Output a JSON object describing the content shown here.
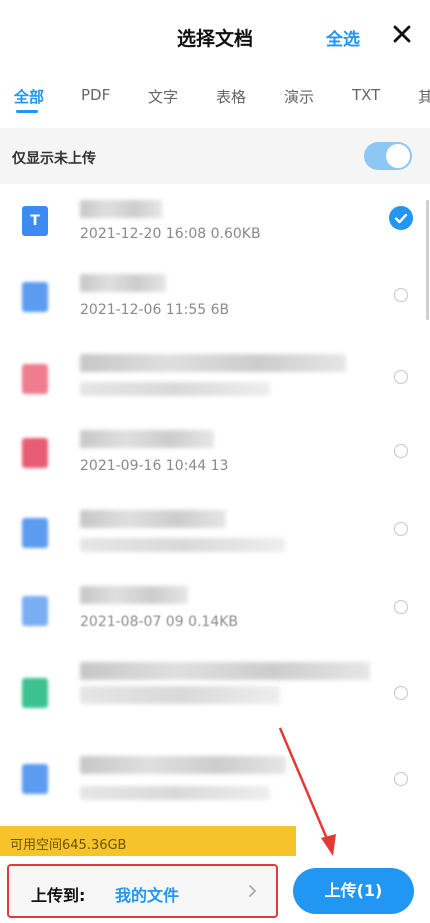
{
  "header": {
    "title": "选择文档",
    "select_all": "全选",
    "close_icon": "close-icon"
  },
  "tabs": [
    {
      "label": "全部",
      "active": true
    },
    {
      "label": "PDF",
      "active": false
    },
    {
      "label": "文字",
      "active": false
    },
    {
      "label": "表格",
      "active": false
    },
    {
      "label": "演示",
      "active": false
    },
    {
      "label": "TXT",
      "active": false
    },
    {
      "label": "其",
      "active": false
    }
  ],
  "filter": {
    "label": "仅显示未上传",
    "toggle_on": true
  },
  "files": [
    {
      "type": "doc",
      "icon_color": "#3d8bf2",
      "icon_glyph": "T",
      "meta": "2021-12-20  16:08  0.60KB",
      "selected": true
    },
    {
      "type": "doc",
      "icon_color": "#5b9cf0",
      "icon_glyph": "",
      "meta": "2021-12-06  11:55  6B",
      "selected": false
    },
    {
      "type": "pdf",
      "icon_color": "#ef7d8e",
      "icon_glyph": "",
      "meta": "",
      "selected": false
    },
    {
      "type": "pdf",
      "icon_color": "#e85d73",
      "icon_glyph": "",
      "meta": "2021-09-16  10:44  13",
      "selected": false
    },
    {
      "type": "doc",
      "icon_color": "#5b9cf0",
      "icon_glyph": "",
      "meta": "",
      "selected": false
    },
    {
      "type": "doc",
      "icon_color": "#7aaef3",
      "icon_glyph": "",
      "meta": "2021-08-07  09  0.14KB",
      "selected": false
    },
    {
      "type": "sheet",
      "icon_color": "#3cc290",
      "icon_glyph": "",
      "meta": "",
      "selected": false
    },
    {
      "type": "doc",
      "icon_color": "#5b9cf0",
      "icon_glyph": "",
      "meta": "",
      "selected": false
    }
  ],
  "storage": {
    "text": "可用空间645.36GB"
  },
  "bottom": {
    "dest_label": "上传到:",
    "dest_value": "我的文件",
    "upload_label": "上传(1)"
  },
  "colors": {
    "accent": "#2196f3",
    "storage_bar": "#f6c32b",
    "annotation": "#e53935"
  }
}
